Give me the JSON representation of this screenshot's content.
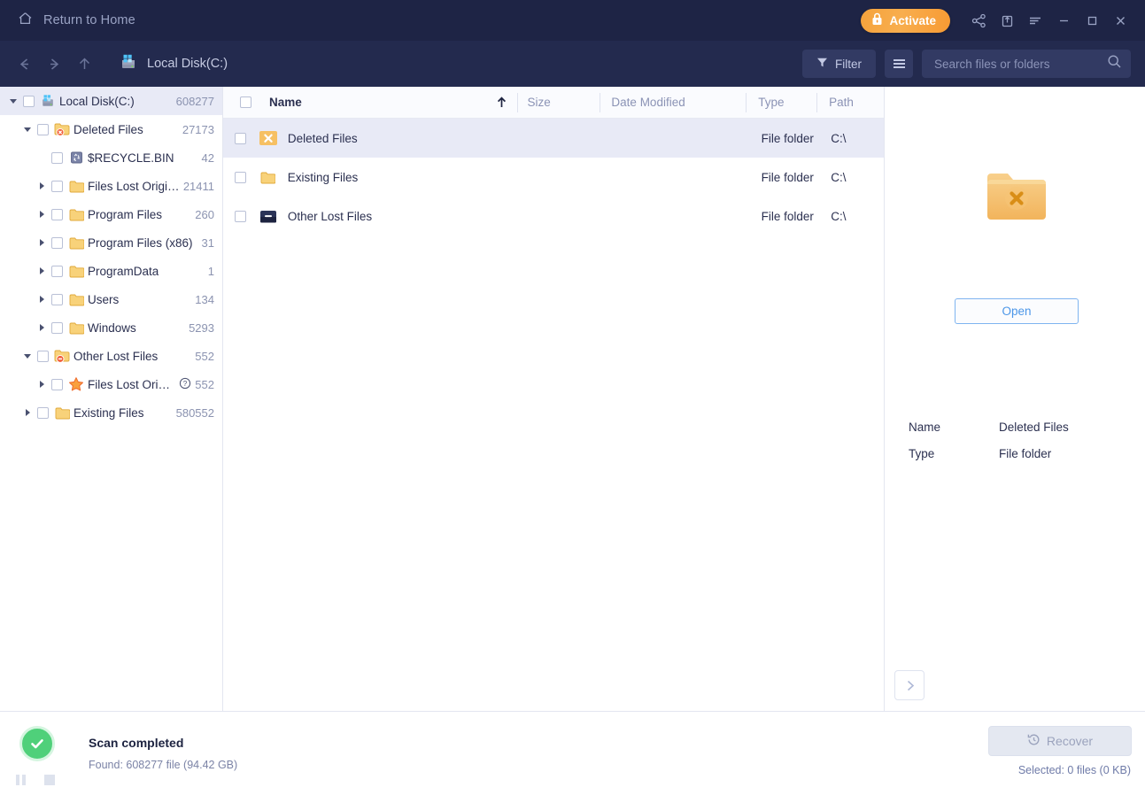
{
  "titlebar": {
    "home_label": "Return to Home",
    "home_icon": "home-icon",
    "activate_label": "Activate",
    "activate_icon": "lock-icon",
    "icons": [
      "share-icon",
      "export-icon",
      "feedback-list-icon"
    ],
    "window_controls": [
      "minimize-icon",
      "maximize-icon",
      "close-icon"
    ],
    "bg_color": "#1e2445",
    "activate_color": "#f7a23e"
  },
  "navbar": {
    "back_icon": "arrow-left-icon",
    "forward_icon": "arrow-right-icon",
    "up_icon": "arrow-up-icon",
    "breadcrumb_icon": "local-disk-icon",
    "breadcrumb_label": "Local Disk(C:)",
    "filter_label": "Filter",
    "filter_icon": "filter-icon",
    "view_menu_icon": "hamburger-icon",
    "search": {
      "placeholder": "Search files or folders",
      "value": "",
      "icon": "search-icon"
    },
    "bg_color": "#232a4e"
  },
  "sidebar": {
    "items": [
      {
        "label": "Local Disk(C:)",
        "count": "608277",
        "indent": 0,
        "caret": "open",
        "icon": "local-disk-icon",
        "selected": true,
        "checked": false,
        "help": false
      },
      {
        "label": "Deleted Files",
        "count": "27173",
        "indent": 1,
        "caret": "open",
        "icon": "folder-deleted-icon",
        "selected": false,
        "checked": false,
        "help": false
      },
      {
        "label": "$RECYCLE.BIN",
        "count": "42",
        "indent": 2,
        "caret": "none",
        "icon": "recycle-bin-icon",
        "selected": false,
        "checked": false,
        "help": false
      },
      {
        "label": "Files Lost Original Di...",
        "count": "21411",
        "indent": 2,
        "caret": "closed",
        "icon": "folder-icon",
        "selected": false,
        "checked": false,
        "help": false
      },
      {
        "label": "Program Files",
        "count": "260",
        "indent": 2,
        "caret": "closed",
        "icon": "folder-icon",
        "selected": false,
        "checked": false,
        "help": false
      },
      {
        "label": "Program Files (x86)",
        "count": "31",
        "indent": 2,
        "caret": "closed",
        "icon": "folder-icon",
        "selected": false,
        "checked": false,
        "help": false
      },
      {
        "label": "ProgramData",
        "count": "1",
        "indent": 2,
        "caret": "closed",
        "icon": "folder-icon",
        "selected": false,
        "checked": false,
        "help": false
      },
      {
        "label": "Users",
        "count": "134",
        "indent": 2,
        "caret": "closed",
        "icon": "folder-icon",
        "selected": false,
        "checked": false,
        "help": false
      },
      {
        "label": "Windows",
        "count": "5293",
        "indent": 2,
        "caret": "closed",
        "icon": "folder-icon",
        "selected": false,
        "checked": false,
        "help": false
      },
      {
        "label": "Other Lost Files",
        "count": "552",
        "indent": 1,
        "caret": "open",
        "icon": "folder-lost-icon",
        "selected": false,
        "checked": false,
        "help": false
      },
      {
        "label": "Files Lost Original ...",
        "count": "552",
        "indent": 2,
        "caret": "closed",
        "icon": "star-icon",
        "selected": false,
        "checked": false,
        "help": true
      },
      {
        "label": "Existing Files",
        "count": "580552",
        "indent": 1,
        "caret": "closed",
        "icon": "folder-icon",
        "selected": false,
        "checked": false,
        "help": false
      }
    ]
  },
  "filelist": {
    "columns": [
      {
        "key": "name",
        "label": "Name"
      },
      {
        "key": "size",
        "label": "Size"
      },
      {
        "key": "date",
        "label": "Date Modified"
      },
      {
        "key": "type",
        "label": "Type"
      },
      {
        "key": "path",
        "label": "Path"
      }
    ],
    "sort_icon": "sort-ascending-icon",
    "rows": [
      {
        "name": "Deleted Files",
        "size": "",
        "date": "",
        "type": "File folder",
        "path": "C:\\",
        "icon": "folder-deleted-square-icon",
        "selected": true,
        "checked": false
      },
      {
        "name": "Existing Files",
        "size": "",
        "date": "",
        "type": "File folder",
        "path": "C:\\",
        "icon": "folder-icon",
        "selected": false,
        "checked": false
      },
      {
        "name": "Other Lost Files",
        "size": "",
        "date": "",
        "type": "File folder",
        "path": "C:\\",
        "icon": "disk-dark-icon",
        "selected": false,
        "checked": false
      }
    ]
  },
  "preview": {
    "thumbnail_icon": "folder-deleted-large-icon",
    "open_label": "Open",
    "properties": [
      {
        "key": "Name",
        "value": "Deleted Files"
      },
      {
        "key": "Type",
        "value": "File folder"
      }
    ],
    "next_icon": "chevron-right-icon"
  },
  "statusbar": {
    "status_icon": "check-circle-icon",
    "title": "Scan completed",
    "subtitle": "Found: 608277 file (94.42 GB)",
    "pause_icon": "pause-icon",
    "stop_icon": "stop-icon",
    "recover_label": "Recover",
    "recover_icon": "recover-clock-icon",
    "selected_text": "Selected: 0 files (0 KB)",
    "status_color": "#4fd07a"
  }
}
